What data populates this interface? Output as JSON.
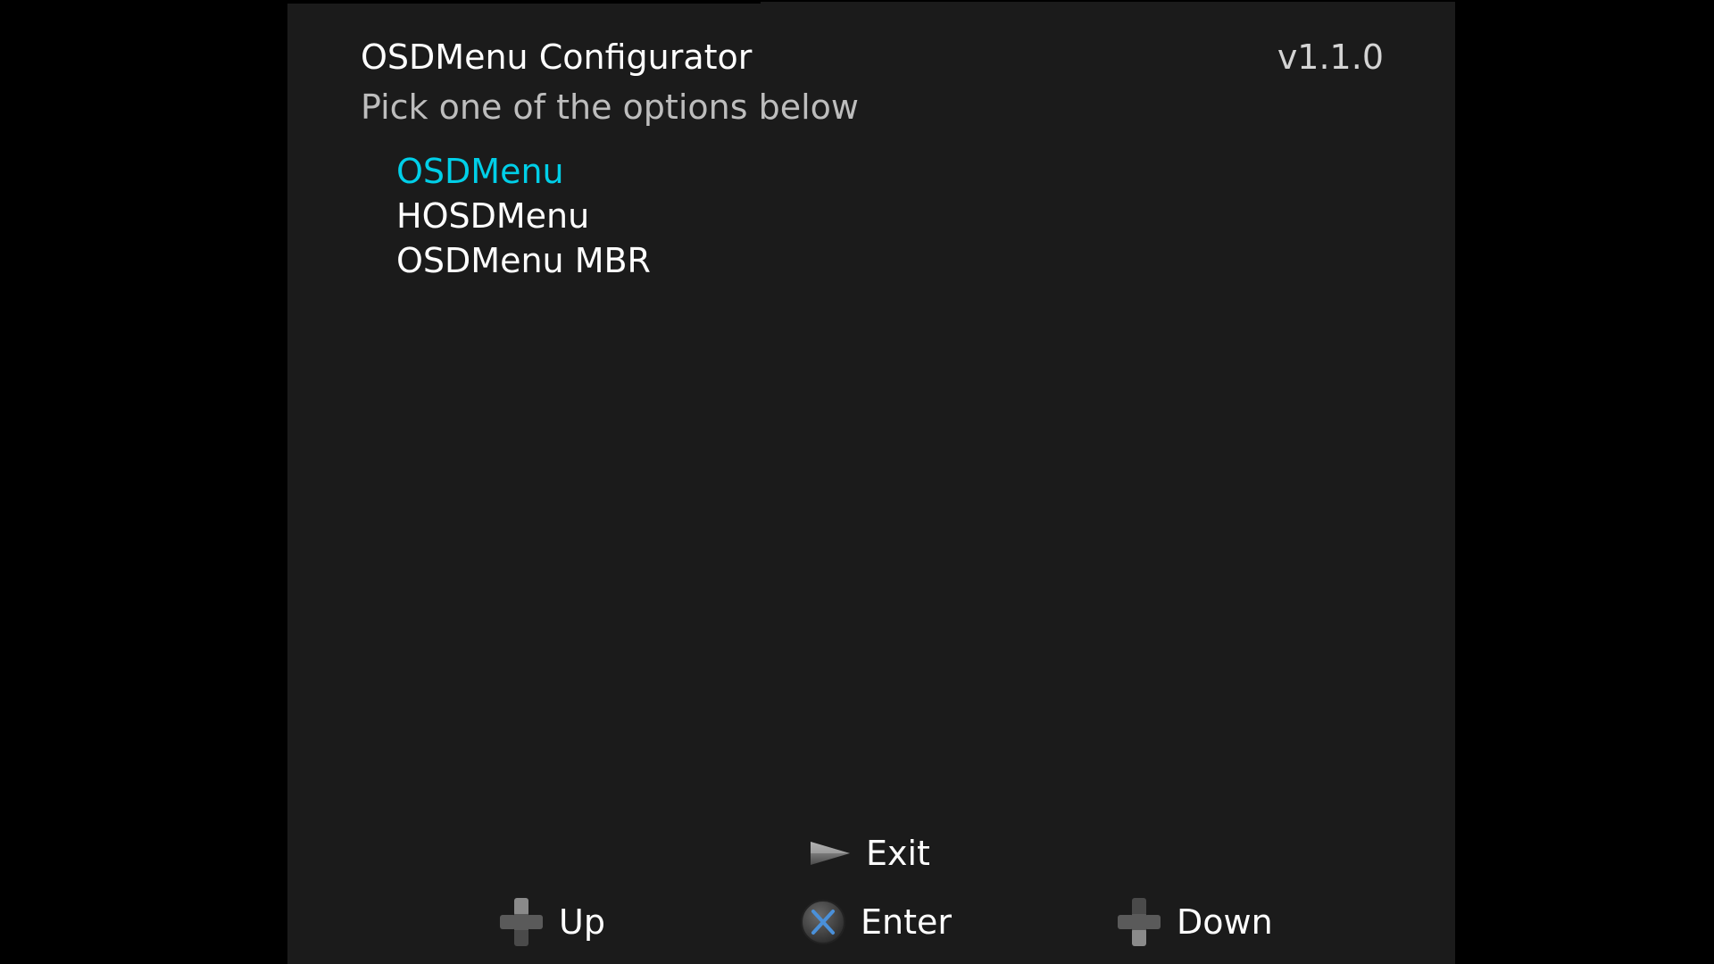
{
  "header": {
    "title": "OSDMenu Configurator",
    "version": "v1.1.0",
    "subtitle": "Pick one of the options below"
  },
  "menu": {
    "selected_index": 0,
    "items": [
      {
        "label": "OSDMenu"
      },
      {
        "label": "HOSDMenu"
      },
      {
        "label": "OSDMenu MBR"
      }
    ]
  },
  "footer": {
    "exit": {
      "label": "Exit",
      "icon": "triangle-button-icon"
    },
    "up": {
      "label": "Up",
      "icon": "dpad-up-icon"
    },
    "enter": {
      "label": "Enter",
      "icon": "cross-button-icon"
    },
    "down": {
      "label": "Down",
      "icon": "dpad-down-icon"
    }
  },
  "colors": {
    "background": "#000000",
    "panel": "#1b1b1b",
    "selected_item": "#00cfe8",
    "text": "#ffffff",
    "subtitle": "#bdbdbd",
    "cross_button": "#4a90d9"
  }
}
